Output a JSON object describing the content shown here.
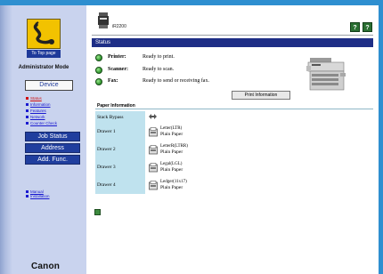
{
  "sidebar": {
    "top_page_label": "To Top page",
    "admin_mode": "Administrator Mode",
    "device_label": "Device",
    "nav": [
      {
        "label": "Status",
        "active": true
      },
      {
        "label": "Information",
        "active": false
      },
      {
        "label": "Features",
        "active": false
      },
      {
        "label": "Network",
        "active": false
      },
      {
        "label": "Counter Check",
        "active": false
      }
    ],
    "buttons": {
      "job_status": "Job Status",
      "address": "Address",
      "add_func": "Add. Func."
    },
    "help_links": [
      "Manual",
      "Installation"
    ],
    "brand": "Canon",
    "colors": {
      "accent": "#2e8fd0",
      "nav_button": "#203e9e"
    }
  },
  "header": {
    "device_name": "iR2200",
    "help_icon": "?",
    "question_icon": "?"
  },
  "status": {
    "title": "Status",
    "rows": [
      {
        "label": "Printer:",
        "value": "Ready to print."
      },
      {
        "label": "Scanner:",
        "value": "Ready to scan."
      },
      {
        "label": "Fax:",
        "value": "Ready to send or receiving fax."
      }
    ],
    "print_info_button": "Print Information",
    "led_color": "#3ea33a"
  },
  "paper": {
    "section_title": "Paper Information",
    "rows": [
      {
        "name": "Stack Bypass",
        "size": "",
        "type": ""
      },
      {
        "name": "Drawer 1",
        "size": "Letter(LTR)",
        "type": "Plain Paper"
      },
      {
        "name": "Drawer 2",
        "size": "LetterR(LTRR)",
        "type": "Plain Paper"
      },
      {
        "name": "Drawer 3",
        "size": "Legal(LGL)",
        "type": "Plain Paper"
      },
      {
        "name": "Drawer 4",
        "size": "Ledger(11x17)",
        "type": "Plain Paper"
      }
    ],
    "name_bg": "#bfe2ee"
  }
}
